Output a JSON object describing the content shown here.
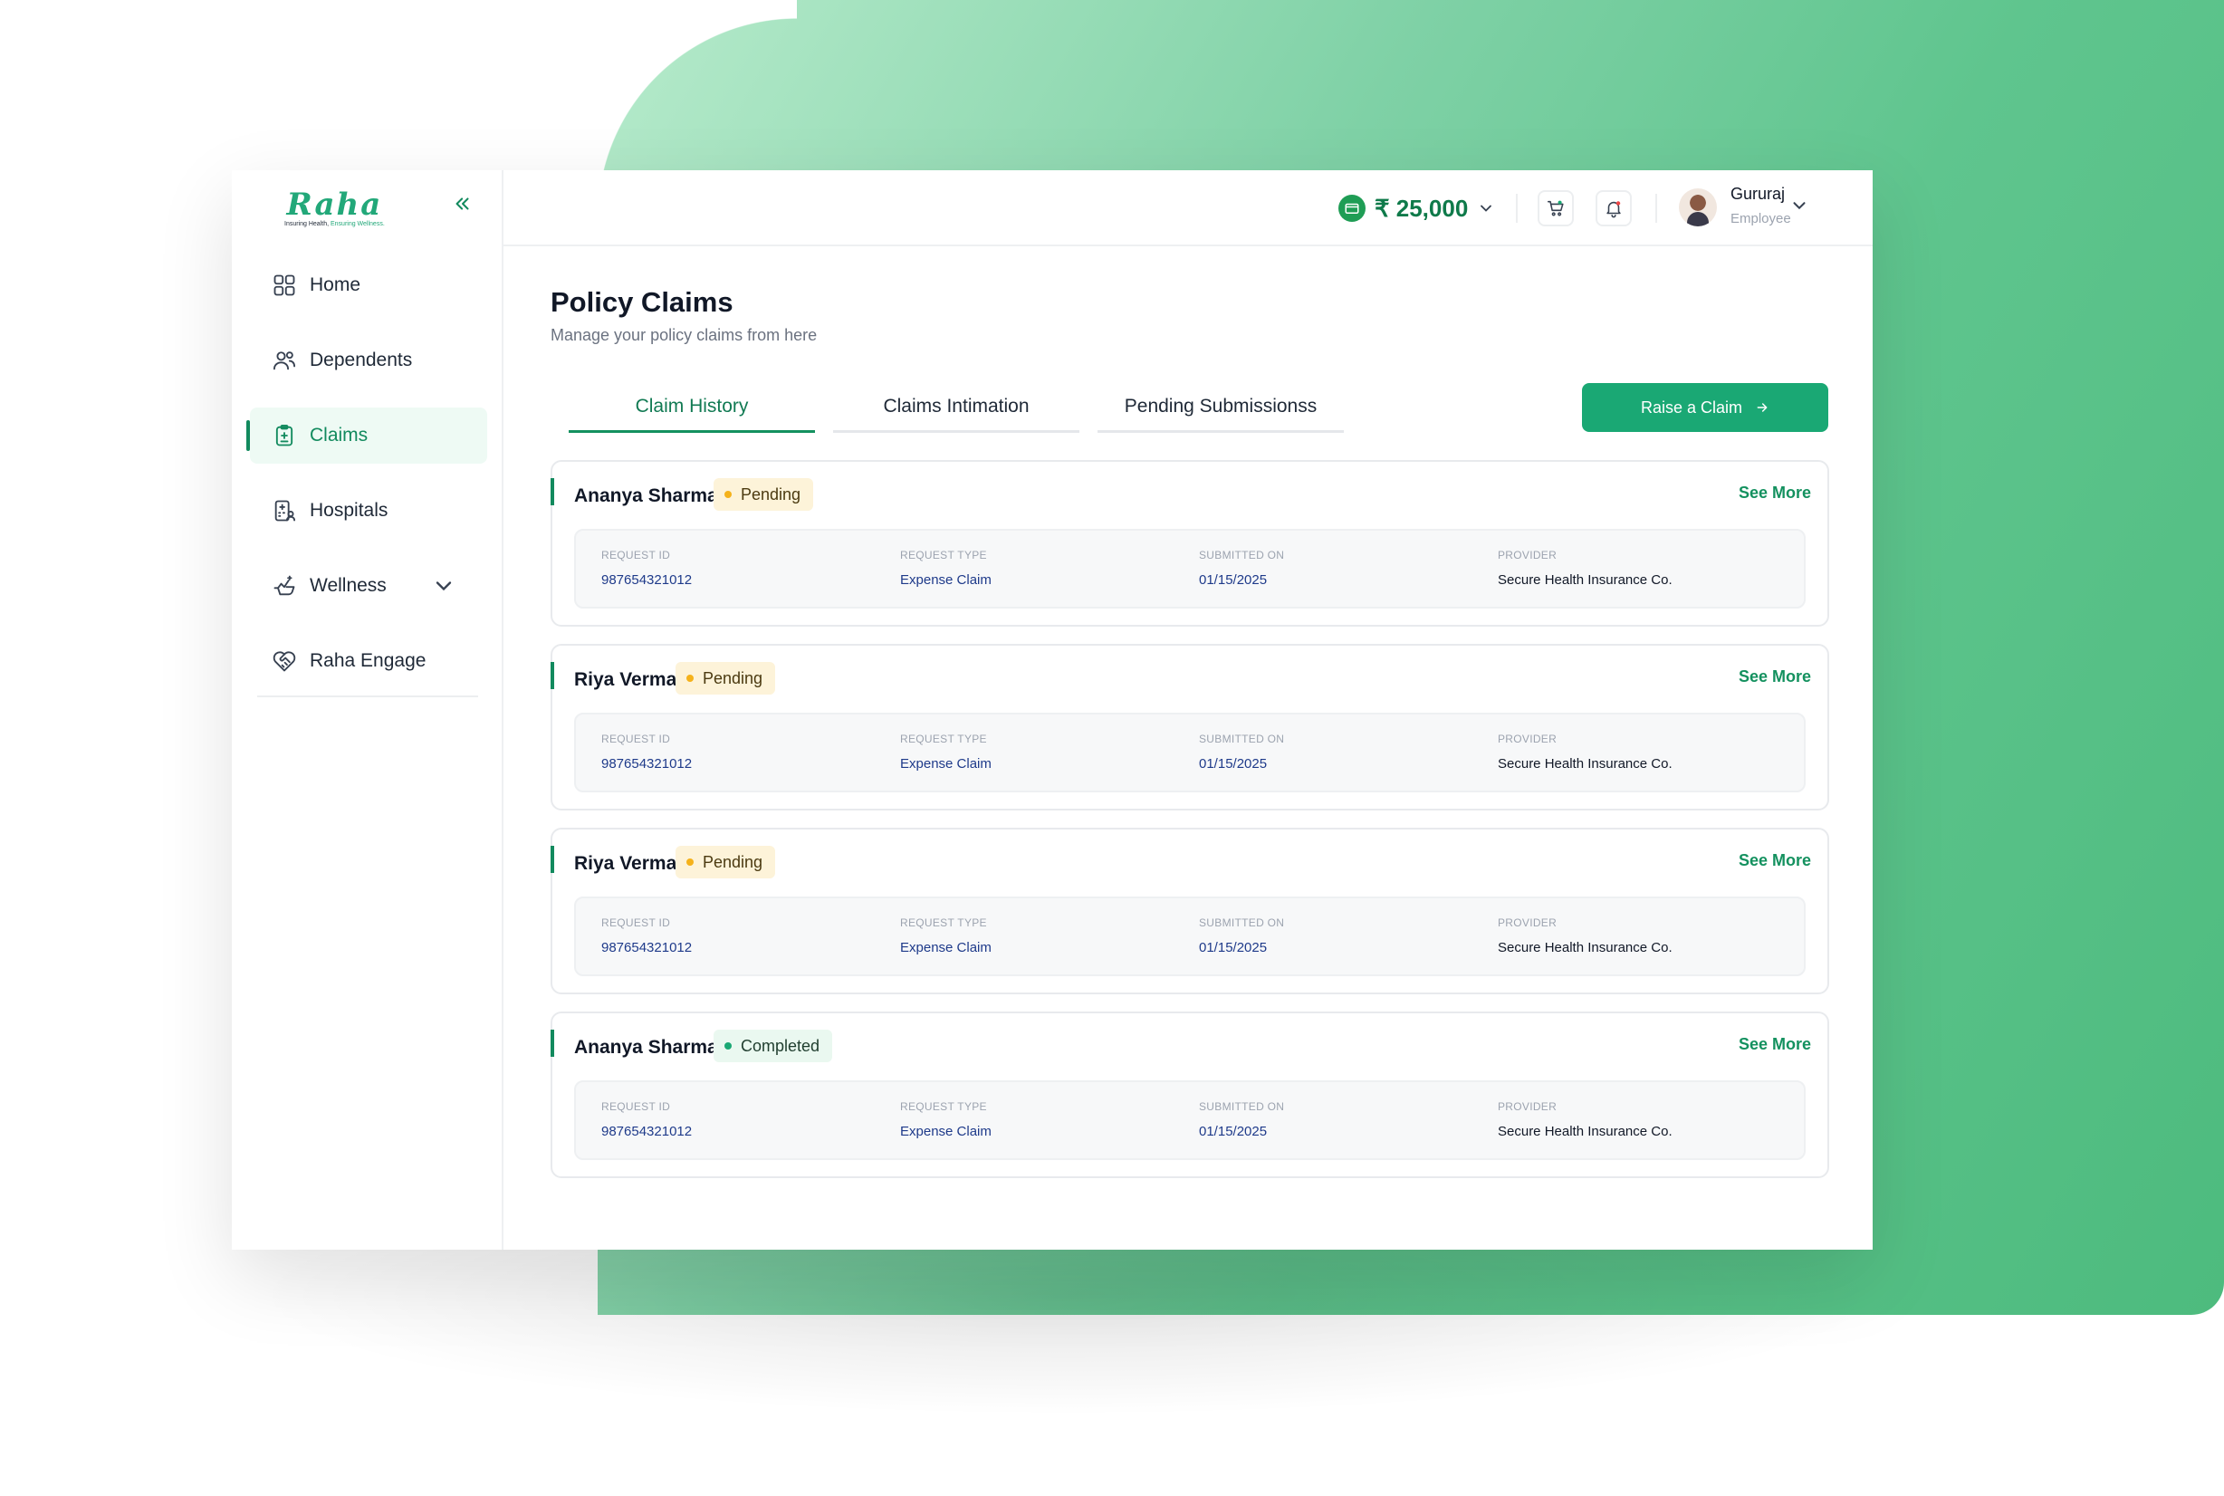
{
  "brand": {
    "logo_text": "Raha",
    "tagline_1": "Insuring Health, ",
    "tagline_2": "Ensuring Wellness."
  },
  "sidebar": {
    "items": [
      {
        "label": "Home",
        "icon": "grid-icon"
      },
      {
        "label": "Dependents",
        "icon": "users-icon"
      },
      {
        "label": "Claims",
        "icon": "clipboard-icon",
        "active": true
      },
      {
        "label": "Hospitals",
        "icon": "hospital-icon"
      },
      {
        "label": "Wellness",
        "icon": "wellness-icon",
        "has_submenu": true
      },
      {
        "label": "Raha Engage",
        "icon": "heart-handshake-icon"
      }
    ]
  },
  "topbar": {
    "wallet_amount": "₹ 25,000",
    "user": {
      "name": "Gururaj",
      "role": "Employee"
    }
  },
  "page": {
    "title": "Policy Claims",
    "subtitle": "Manage your policy claims from here"
  },
  "tabs": [
    {
      "label": "Claim History",
      "active": true
    },
    {
      "label": "Claims Intimation"
    },
    {
      "label": "Pending Submissionss"
    }
  ],
  "raise_button": "Raise a Claim",
  "columns": [
    "REQUEST ID",
    "REQUEST TYPE",
    "SUBMITTED ON",
    "PROVIDER"
  ],
  "see_more": "See More",
  "claims": [
    {
      "name": "Ananya Sharma",
      "status": "Pending",
      "request_id": "987654321012",
      "request_type": "Expense Claim",
      "submitted_on": "01/15/2025",
      "provider": "Secure Health Insurance Co."
    },
    {
      "name": "Riya Verma",
      "status": "Pending",
      "request_id": "987654321012",
      "request_type": "Expense Claim",
      "submitted_on": "01/15/2025",
      "provider": "Secure Health Insurance Co."
    },
    {
      "name": "Riya Verma",
      "status": "Pending",
      "request_id": "987654321012",
      "request_type": "Expense Claim",
      "submitted_on": "01/15/2025",
      "provider": "Secure Health Insurance Co."
    },
    {
      "name": "Ananya Sharma",
      "status": "Completed",
      "request_id": "987654321012",
      "request_type": "Expense Claim",
      "submitted_on": "01/15/2025",
      "provider": "Secure Health Insurance Co."
    }
  ],
  "colors": {
    "accent": "#1aa874",
    "active_text": "#128a5e",
    "pending_bg": "#fdf3d9",
    "completed_bg": "#eaf8f0"
  }
}
